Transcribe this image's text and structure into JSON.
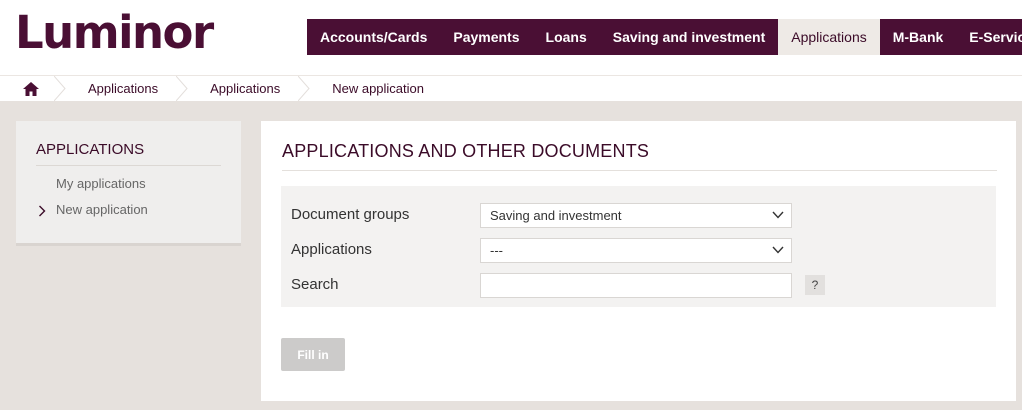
{
  "header": {
    "logo": "Luminor",
    "nav": [
      {
        "label": "Accounts/Cards"
      },
      {
        "label": "Payments"
      },
      {
        "label": "Loans"
      },
      {
        "label": "Saving and investment"
      },
      {
        "label": "Applications"
      },
      {
        "label": "M-Bank"
      },
      {
        "label": "E-Services"
      }
    ],
    "active_nav": "Applications"
  },
  "breadcrumb": {
    "home_icon": "home-icon",
    "items": [
      "Applications",
      "Applications",
      "New application"
    ]
  },
  "sidebar": {
    "title": "APPLICATIONS",
    "items": [
      "My applications",
      "New application"
    ],
    "selected": "New application"
  },
  "main": {
    "title": "APPLICATIONS AND OTHER DOCUMENTS",
    "form": {
      "document_groups_label": "Document groups",
      "document_groups_value": "Saving and investment",
      "applications_label": "Applications",
      "applications_value": "---",
      "search_label": "Search",
      "search_value": "",
      "help_label": "?"
    },
    "fill_in_label": "Fill in"
  },
  "colors": {
    "brand": "#4a0f34",
    "page_bg": "#e6e1dd",
    "panel_bg": "#efeeed",
    "disabled_button": "#cccbca"
  }
}
